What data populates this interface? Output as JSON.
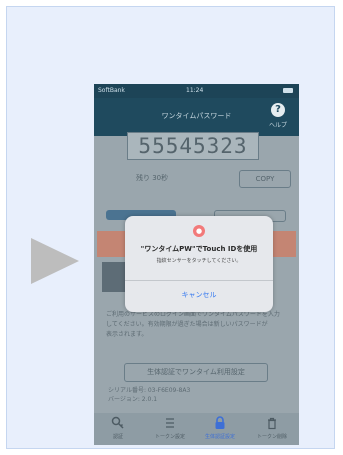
{
  "phone": {
    "status": {
      "carrier": "SoftBank",
      "time": "11:24"
    },
    "nav": {
      "title": "ワンタイムパスワード",
      "help_label": "ヘルプ",
      "help_glyph": "?"
    },
    "code": "55545323",
    "remaining": "残り 30秒",
    "copy_label": "COPY",
    "notes": [
      "ご利用のサービスのログイン画面でワンタイムパスワードを入力",
      "してください。有効期限が過ぎた場合は新しいパスワードが",
      "表示されます。"
    ],
    "outline_button": "生体認証でワンタイム利用設定",
    "small_info": [
      "シリアル番号: 03-F6E09-8A3",
      "バージョン: 2.0.1"
    ],
    "tabbar": [
      {
        "label": "認証",
        "icon": "key-icon"
      },
      {
        "label": "トークン設定",
        "icon": "list-icon"
      },
      {
        "label": "生体認証設定",
        "icon": "lock-icon",
        "active": true
      },
      {
        "label": "トークン削除",
        "icon": "trash-icon"
      }
    ]
  },
  "dialog": {
    "title": "\"ワンタイムPW\"でTouch IDを使用",
    "message": "指紋センサーをタッチしてください。",
    "cancel": "キャンセル"
  },
  "colors": {
    "panel_bg": "#e8effc",
    "nav_bg": "#1f4a5e",
    "active_tab": "#3d6fd6",
    "dialog_link": "#3478f0",
    "arrow": "#bdbdbd"
  }
}
